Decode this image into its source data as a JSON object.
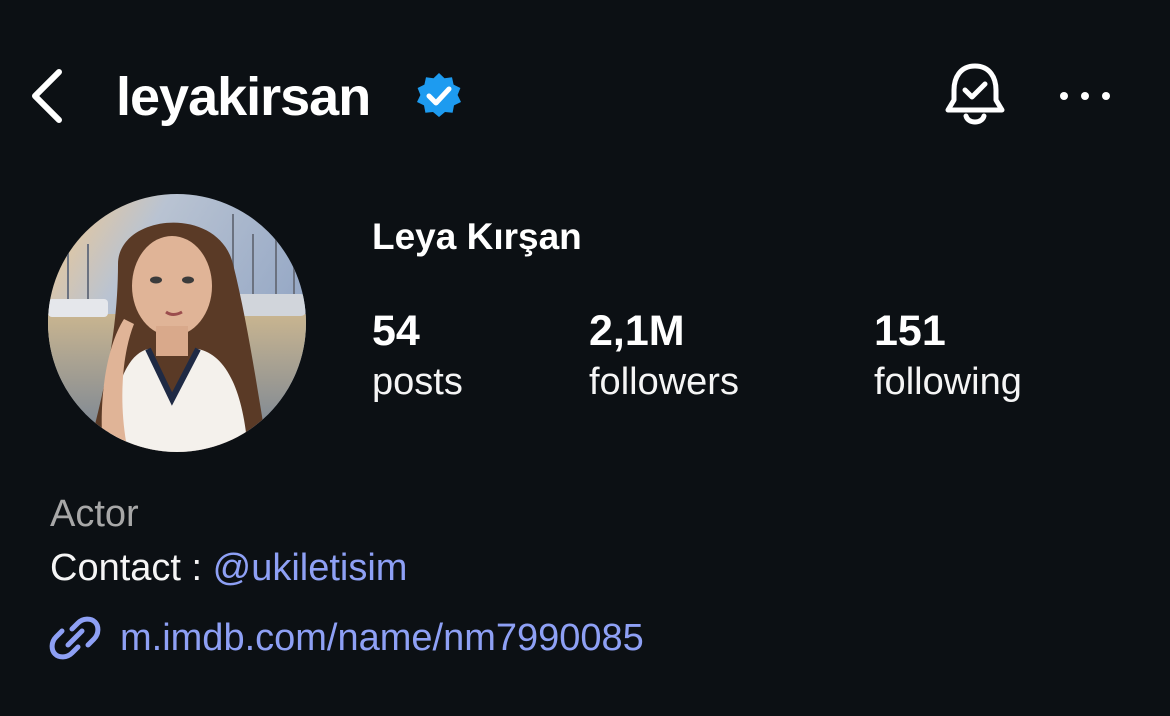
{
  "header": {
    "back_icon": "chevron-left-icon",
    "username": "leyakirsan",
    "verified_icon": "verified-badge-icon",
    "verified_color": "#1d9bf0",
    "notifications_icon": "bell-check-icon",
    "more_icon": "more-horizontal-icon"
  },
  "profile": {
    "avatar_icon": "profile-photo",
    "display_name": "Leya Kırşan",
    "stats": {
      "posts": {
        "value": "54",
        "label": "posts"
      },
      "followers": {
        "value": "2,1M",
        "label": "followers"
      },
      "following": {
        "value": "151",
        "label": "following"
      }
    }
  },
  "bio": {
    "category": "Actor",
    "contact_prefix": "Contact : ",
    "contact_handle": "@ukiletisim",
    "link_icon": "link-icon",
    "link_text": "m.imdb.com/name/nm7990085",
    "link_color": "#8ea0f5"
  }
}
